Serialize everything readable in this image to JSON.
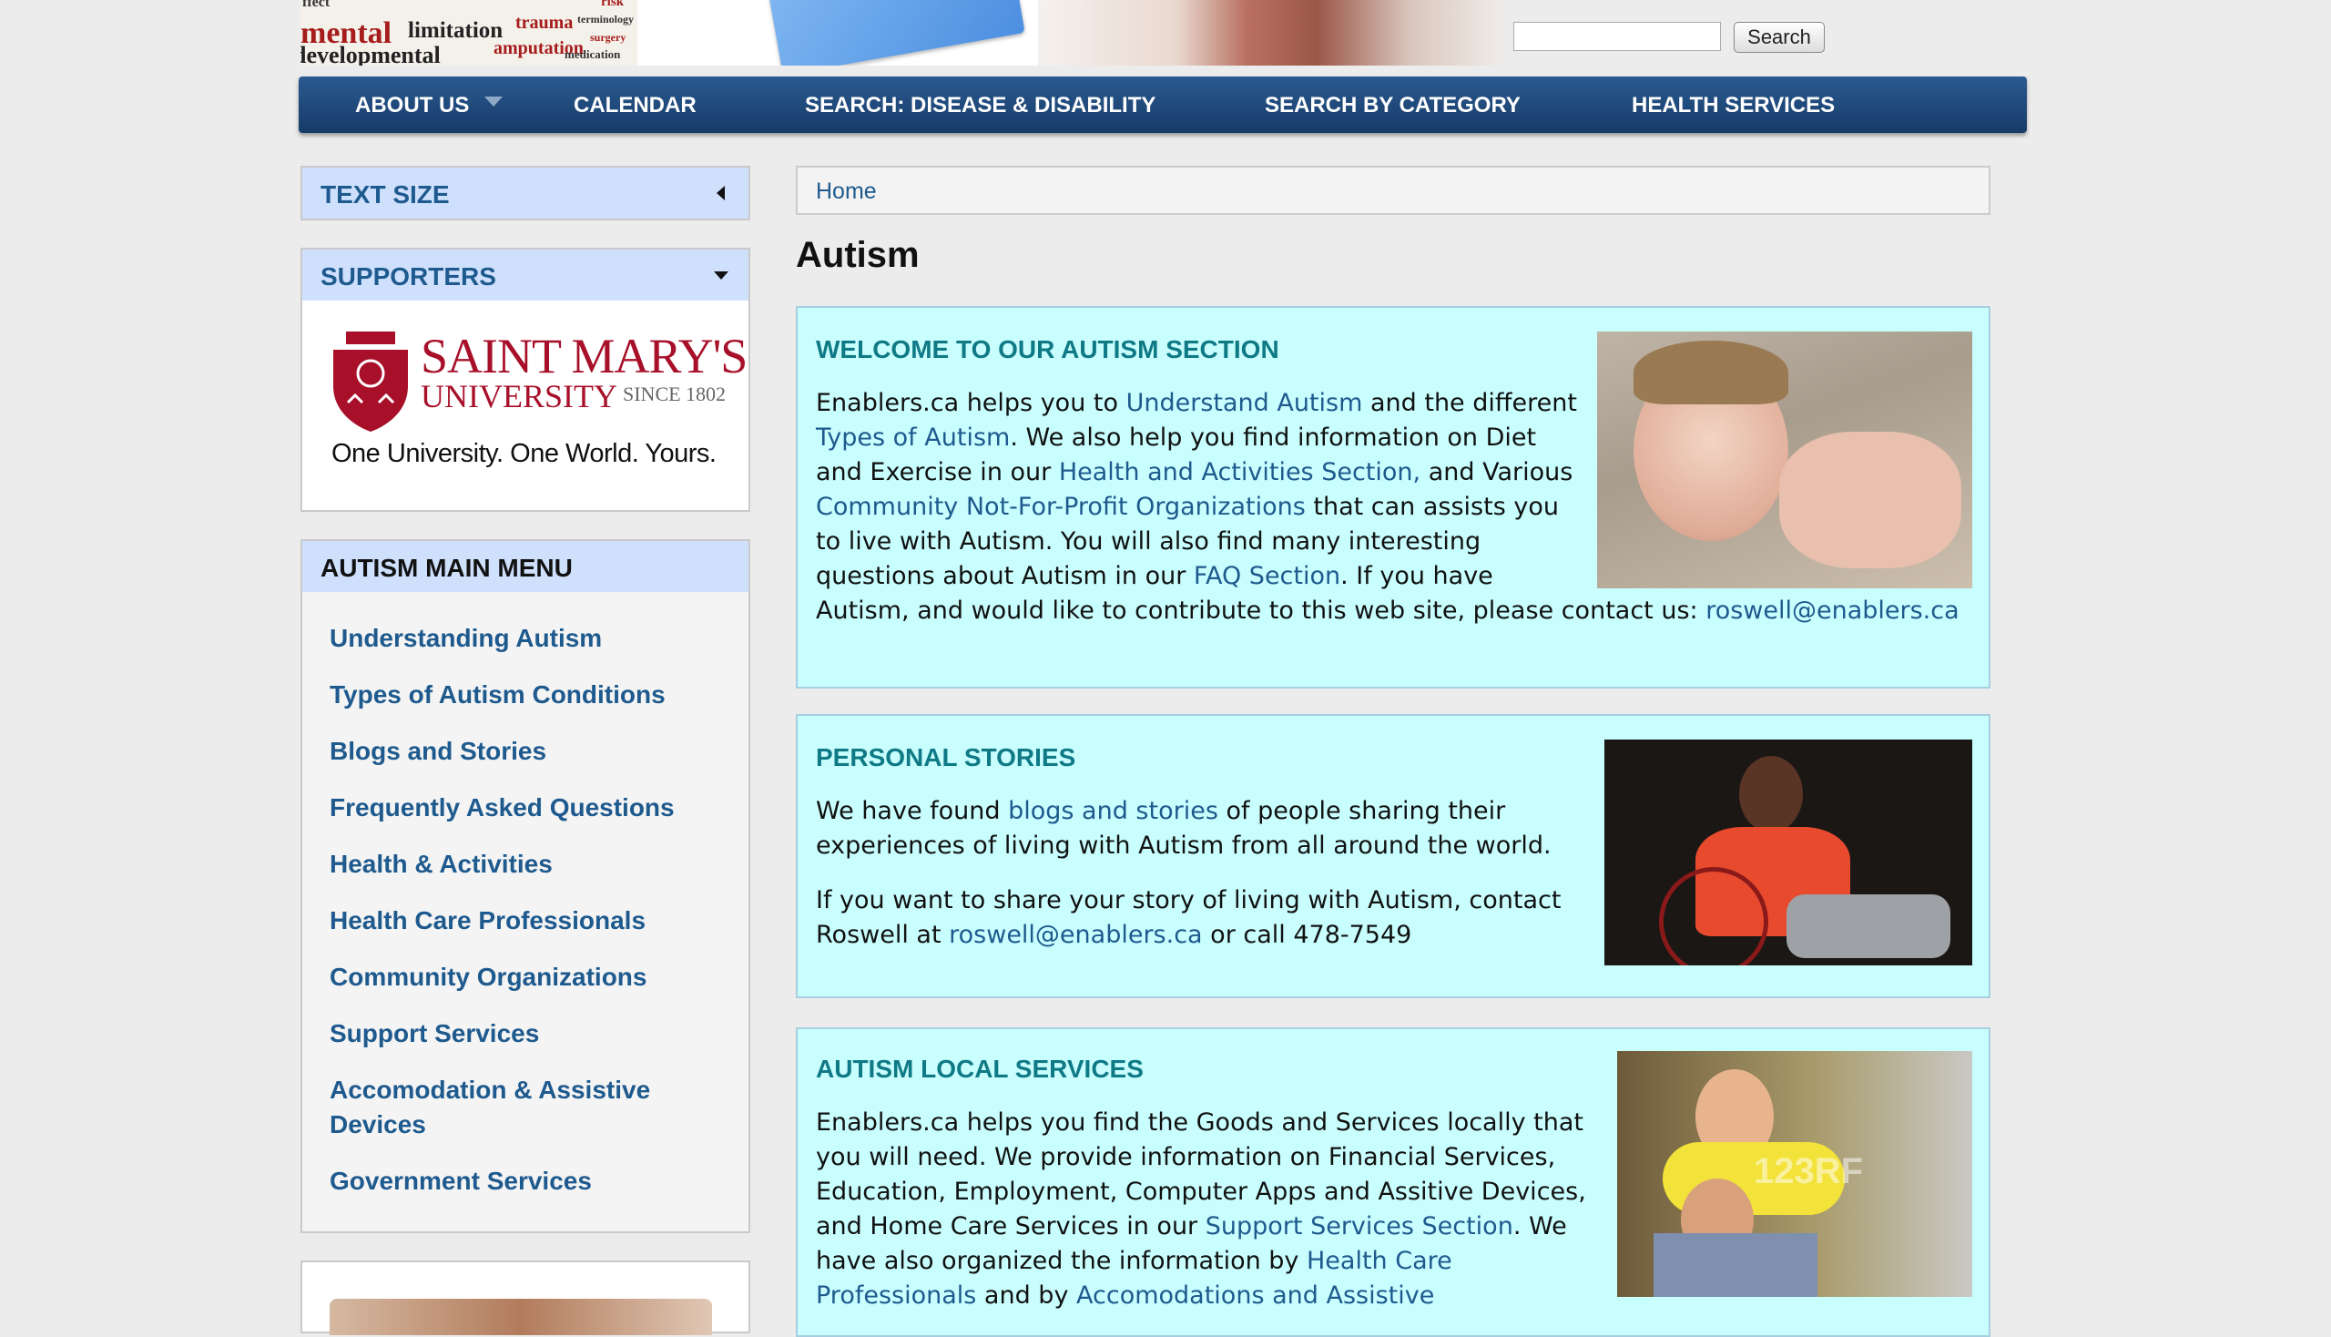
{
  "header": {
    "banner_words": [
      "ffect",
      "mental",
      "limitation",
      "trauma",
      "terminology",
      "developmental",
      "amputation",
      "surgery",
      "medication",
      "risk"
    ],
    "search_placeholder": "",
    "search_button": "Search"
  },
  "nav": {
    "items": [
      "ABOUT US",
      "CALENDAR",
      "SEARCH: DISEASE & DISABILITY",
      "SEARCH BY CATEGORY",
      "HEALTH SERVICES"
    ]
  },
  "sidebar": {
    "text_size": "TEXT SIZE",
    "supporters": "SUPPORTERS",
    "supporter_logo": {
      "name_line1": "SAINT MARY'S",
      "name_line2": "UNIVERSITY",
      "since": "SINCE 1802",
      "tagline": "One University. One World. Yours."
    },
    "menu_title": "AUTISM MAIN MENU",
    "menu_items": [
      "Understanding Autism",
      "Types of Autism Conditions",
      "Blogs and Stories",
      "Frequently Asked Questions",
      "Health & Activities",
      "Health Care Professionals",
      "Community Organizations",
      "Support Services",
      "Accomodation & Assistive Devices",
      "Government Services"
    ]
  },
  "main": {
    "breadcrumb_home": "Home",
    "page_title": "Autism",
    "welcome": {
      "title": "WELCOME TO OUR AUTISM SECTION",
      "t1": "Enablers.ca helps you to ",
      "l1": "Understand Autism",
      "t2": " and the different ",
      "l2": "Types of Autism",
      "t3": ". We also help you find information on Diet and Exercise in our ",
      "l3": "Health and Activities Section,",
      "t4": " and Various ",
      "l4": "Community Not-For-Profit Organizations",
      "t5": " that can assists you to live with Autism. You will also find many interesting questions about Autism in our ",
      "l5": "FAQ Section",
      "t6": ".  If you have Autism, and would like to contribute to this web site, please contact us: ",
      "l6": "roswell@enablers.ca"
    },
    "stories": {
      "title": "PERSONAL STORIES",
      "p1_t1": "We have found ",
      "p1_l1": "blogs and stories",
      "p1_t2": " of people sharing their experiences of living with Autism from all around the world.",
      "p2_t1": "If you want to share your story of living with Autism, contact Roswell at  ",
      "p2_l1": "roswell@enablers.ca",
      "p2_t2": "  or call 478-7549"
    },
    "local": {
      "title": "AUTISM LOCAL SERVICES",
      "t1": "Enablers.ca helps you find the Goods and Services locally that you will need.  We provide information on Financial Services, Education, Employment, Computer Apps and Assitive Devices, and Home Care Services in our ",
      "l1": "Support Services Section",
      "t2": ". We have also organized the information by ",
      "l2": "Health Care Professionals",
      "t3": " and by ",
      "l3": "Accomodations and Assistive"
    },
    "photo_watermark": "123RF"
  },
  "colors": {
    "nav_bg": "#1f4a7c",
    "link": "#1e5a8e",
    "section_bg": "#c9fefe",
    "section_title": "#0f7a86",
    "sidebar_head_bg": "#cfe0fd",
    "smu_red": "#a8102a"
  }
}
